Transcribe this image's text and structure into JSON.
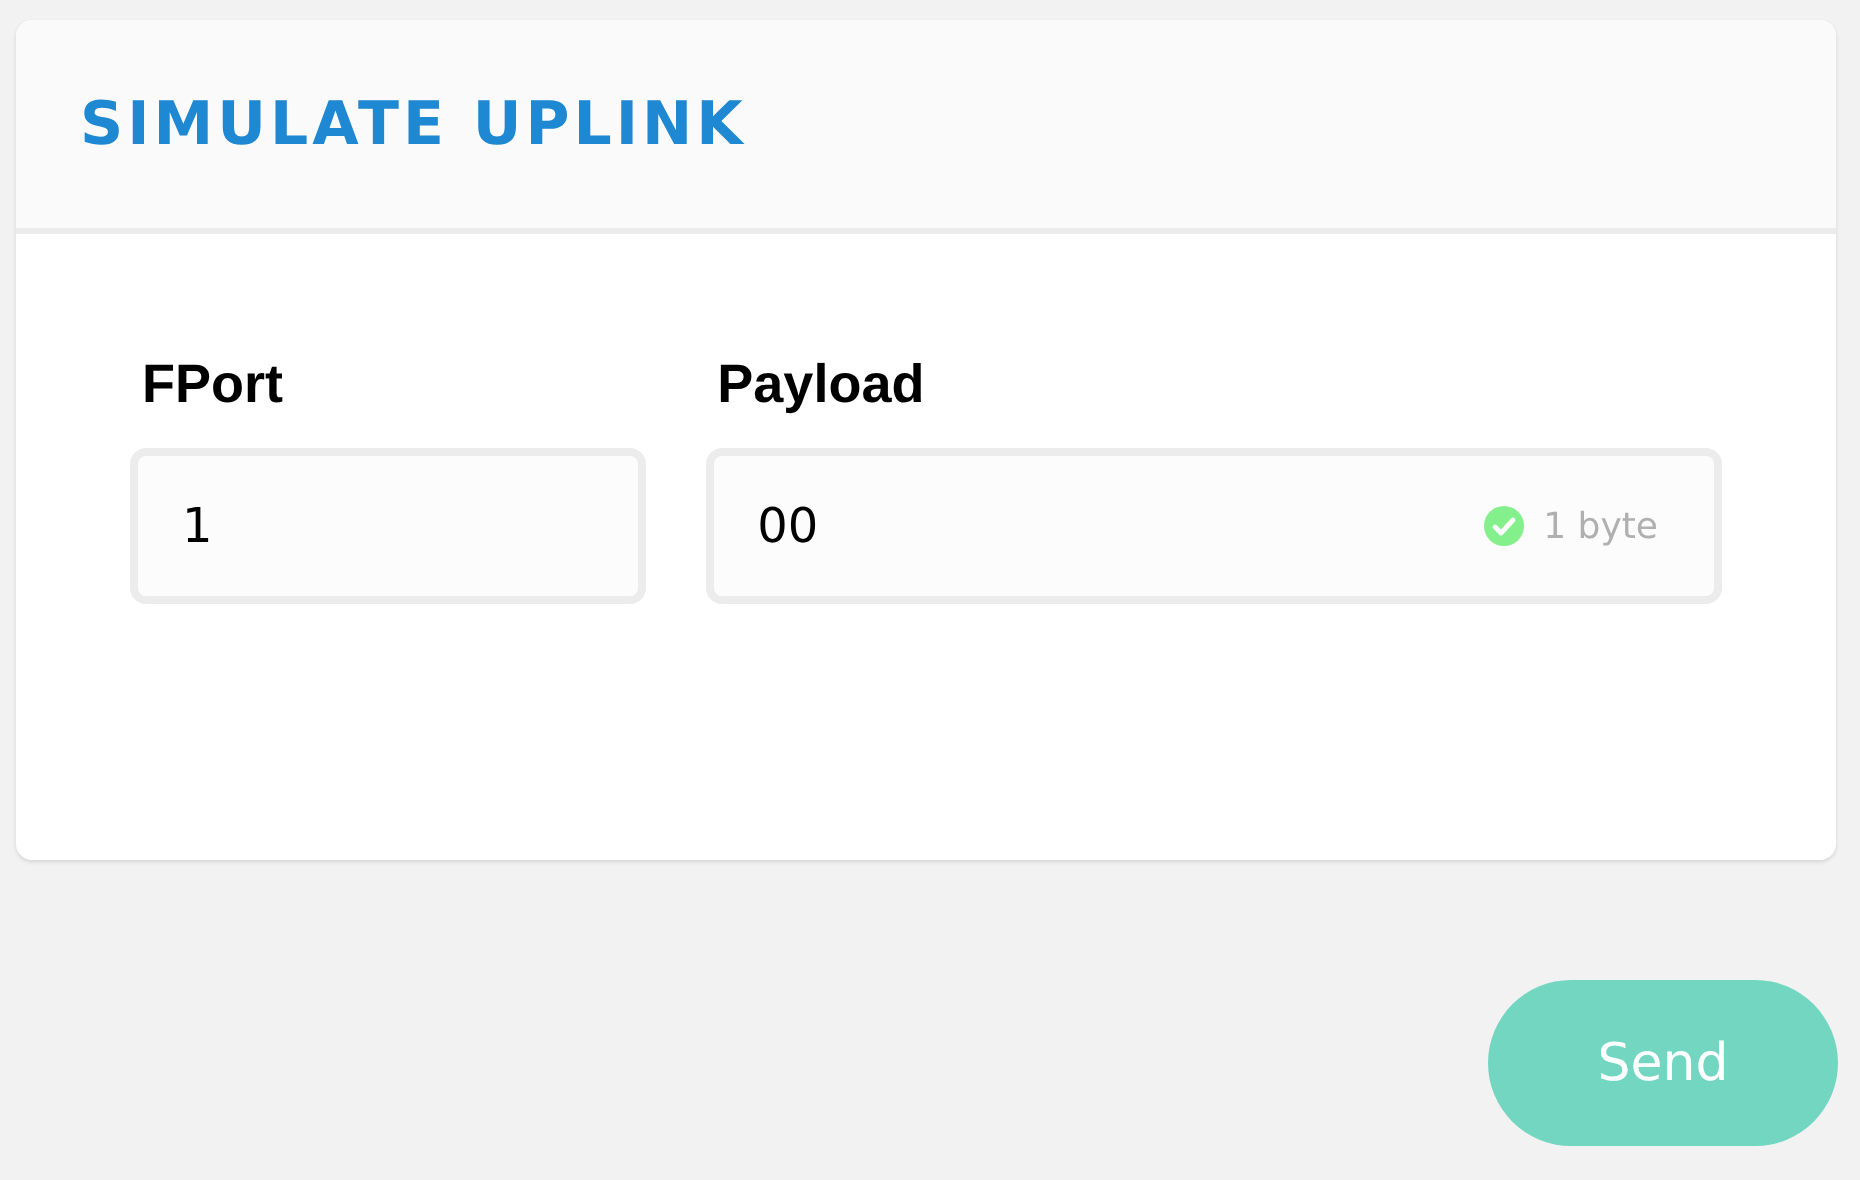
{
  "card": {
    "title": "SIMULATE UPLINK"
  },
  "fields": [
    {
      "label": "FPort",
      "value": "1"
    },
    {
      "label": "Payload",
      "value": "00",
      "hint": "1 byte",
      "valid": true
    }
  ],
  "send_button": {
    "label": "Send"
  }
}
